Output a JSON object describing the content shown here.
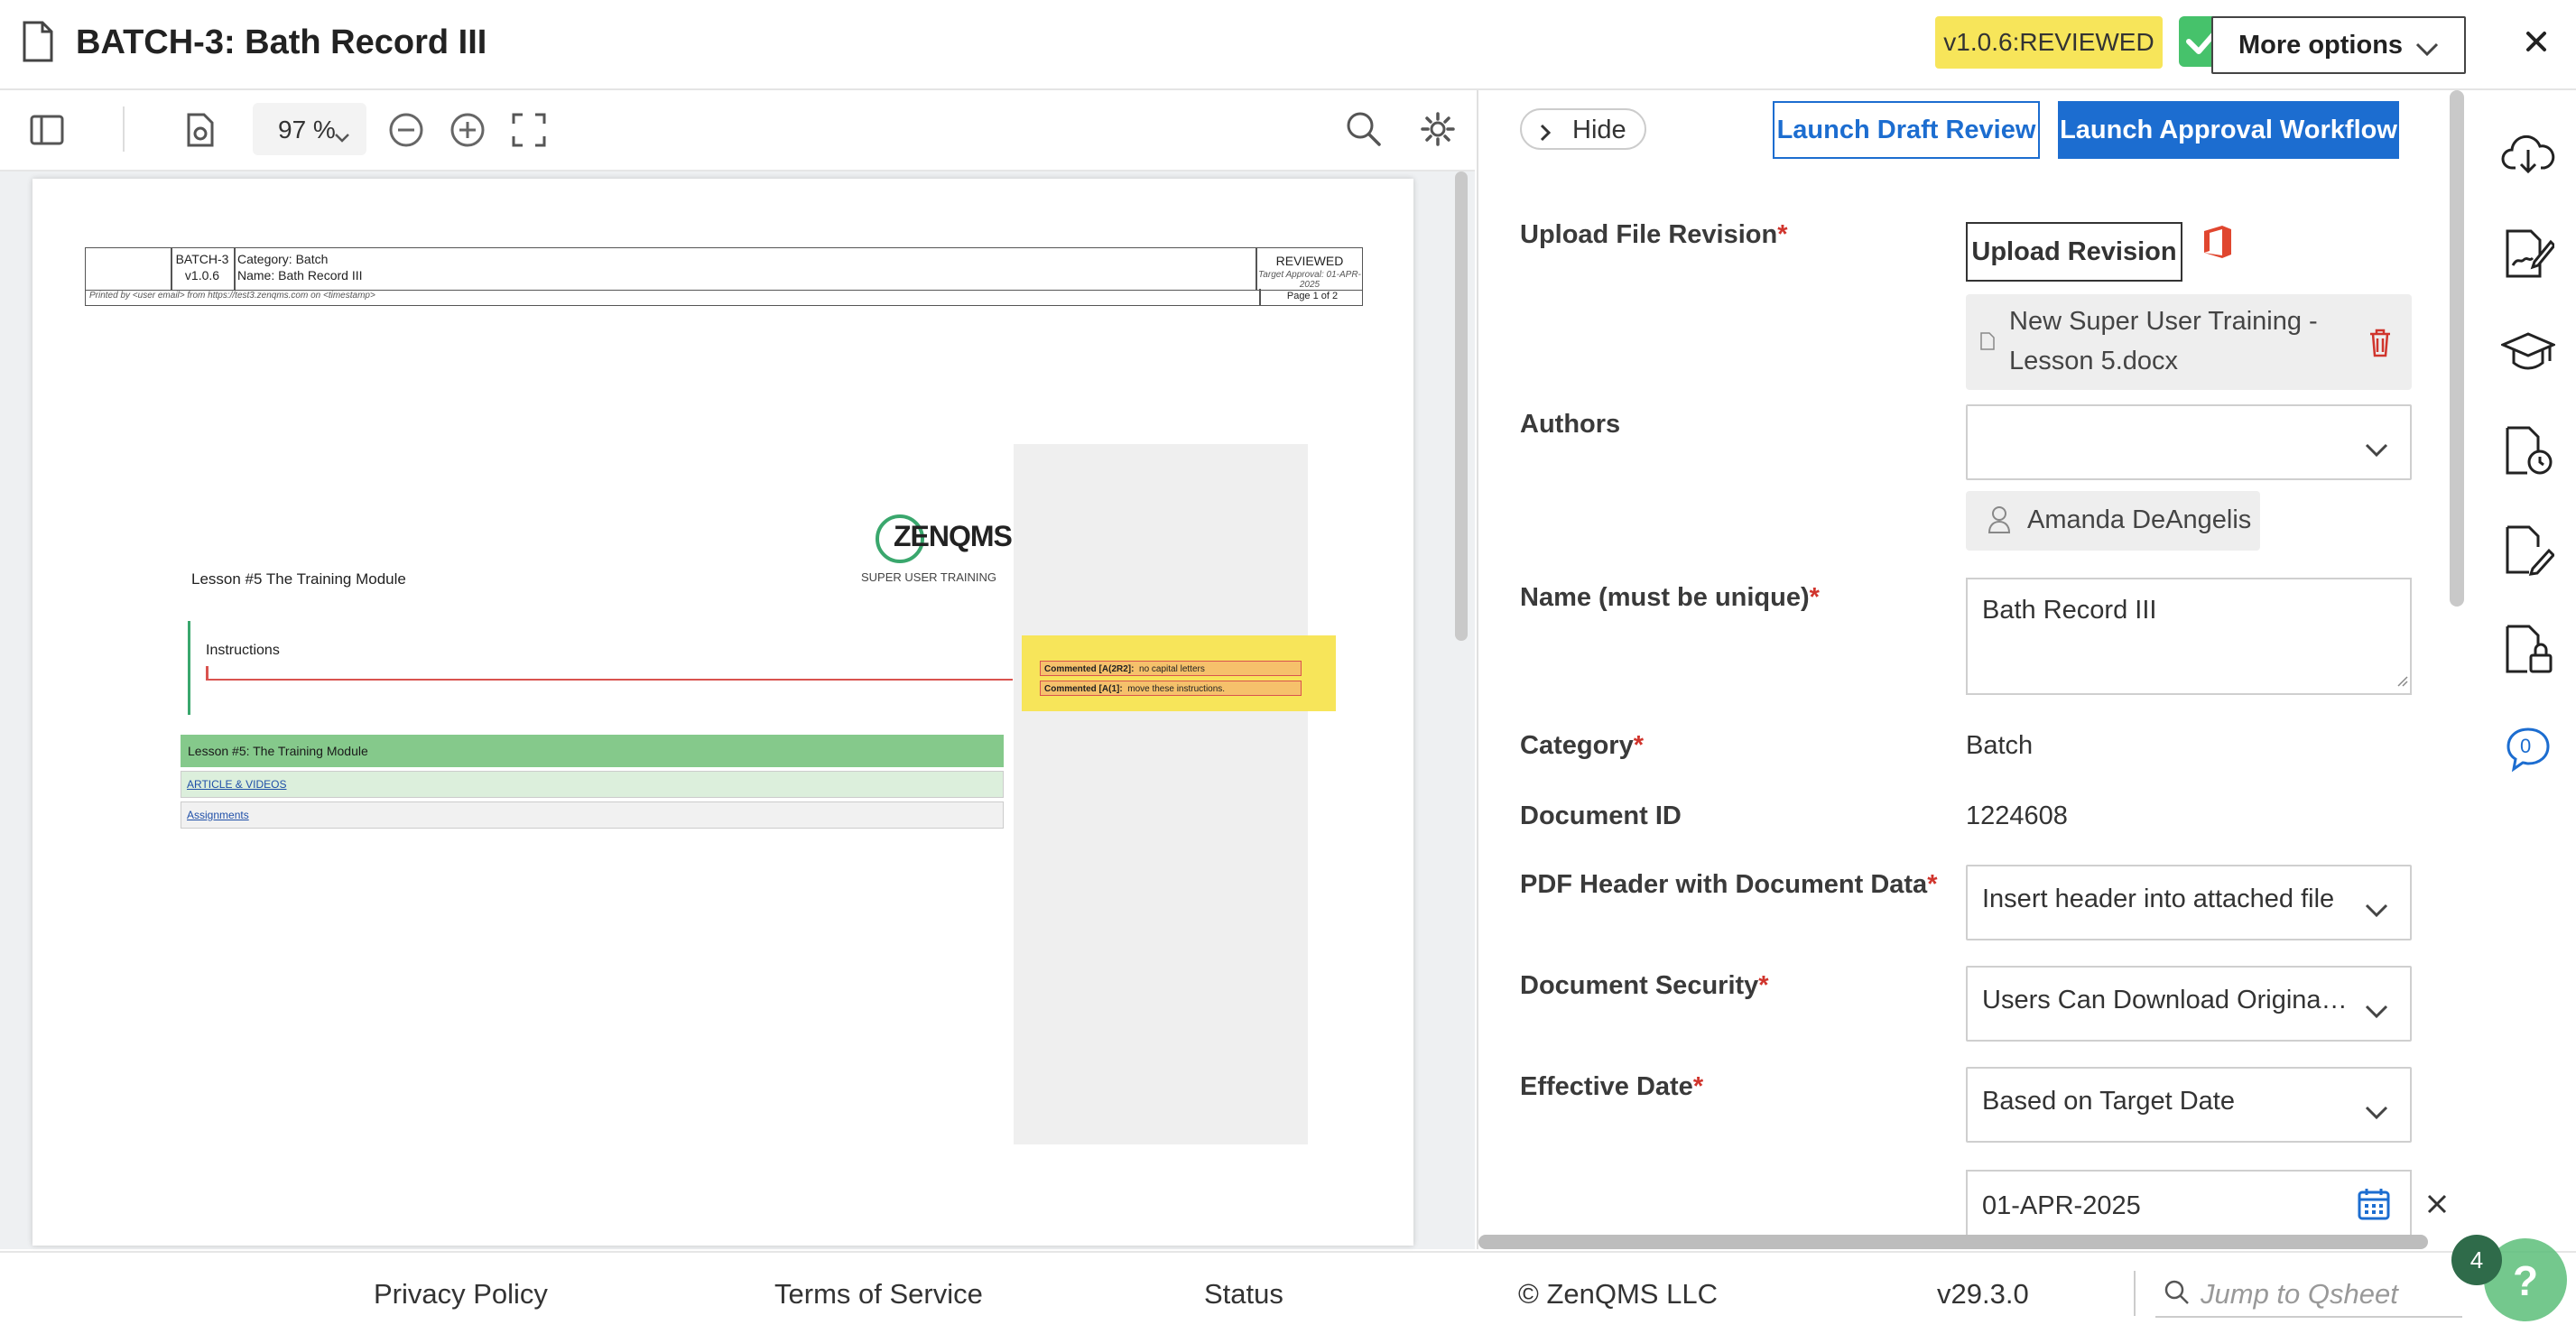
{
  "header": {
    "title": "BATCH-3: Bath Record III",
    "version_badge": "v1.0.6:REVIEWED",
    "more_options_label": "More options",
    "doc_icon": "document-icon",
    "close_icon": "close-icon",
    "colors": {
      "version_badge": "#f7e55a",
      "check": "#46c26b"
    }
  },
  "viewer": {
    "zoom": "97 %",
    "icons": [
      "sidebar-toggle-icon",
      "page-settings-icon",
      "zoom-out-icon",
      "zoom-in-icon",
      "fullscreen-icon",
      "search-icon",
      "gear-icon"
    ],
    "document": {
      "header_id": "BATCH-3",
      "header_version": "v1.0.6",
      "header_category": "Category: Batch",
      "header_name": "Name: Bath Record III",
      "header_status": "REVIEWED",
      "header_target": "Target Approval: 01-APR-2025",
      "printed_by": "Printed by <user email> from https://test3.zenqms.com on <timestamp>",
      "page_of": "Page 1 of 2",
      "logo_text": "ZENQMS",
      "logo_tag": "SUPER USER TRAINING",
      "lesson_title": "Lesson #5 The Training Module",
      "instructions": "Instructions",
      "comment1_label": "Commented [A(2R2]:",
      "comment1_text": "no capital letters",
      "comment2_label": "Commented [A(1]:",
      "comment2_text": "move these instructions.",
      "table_header": "Lesson #5: The Training Module",
      "link1": "ARTICLE & VIDEOS",
      "link2": "Assignments"
    }
  },
  "panel": {
    "hide_label": "Hide",
    "launch_draft_label": "Launch Draft Review",
    "launch_approval_label": "Launch Approval Workflow",
    "upload_label": "Upload File Revision",
    "upload_button": "Upload Revision",
    "office_icon": "office-icon",
    "file_name_line1": "New Super User Training -",
    "file_name_line2": "Lesson 5.docx",
    "authors_label": "Authors",
    "author_name": "Amanda DeAngelis",
    "name_label": "Name (must be unique)",
    "name_value": "Bath Record III",
    "category_label": "Category",
    "category_value": "Batch",
    "docid_label": "Document ID",
    "docid_value": "1224608",
    "pdf_header_label": "PDF Header with Document Data",
    "pdf_header_value": "Insert header into attached file",
    "security_label": "Document Security",
    "security_value": "Users Can Download Original File",
    "effective_label": "Effective Date",
    "effective_value": "Based on Target Date",
    "date_value": "01-APR-2025",
    "required_mark": "*"
  },
  "rail": {
    "icons": [
      "cloud-download-icon",
      "signature-icon",
      "training-cap-icon",
      "document-history-icon",
      "document-edit-icon",
      "document-lock-icon",
      "comments-icon"
    ],
    "comment_count": "0"
  },
  "footer": {
    "privacy": "Privacy Policy",
    "terms": "Terms of Service",
    "status": "Status",
    "copyright": "© ZenQMS LLC",
    "version": "v29.3.0",
    "search_placeholder": "Jump to Qsheet",
    "help_badge": "4",
    "help_label": "?"
  }
}
